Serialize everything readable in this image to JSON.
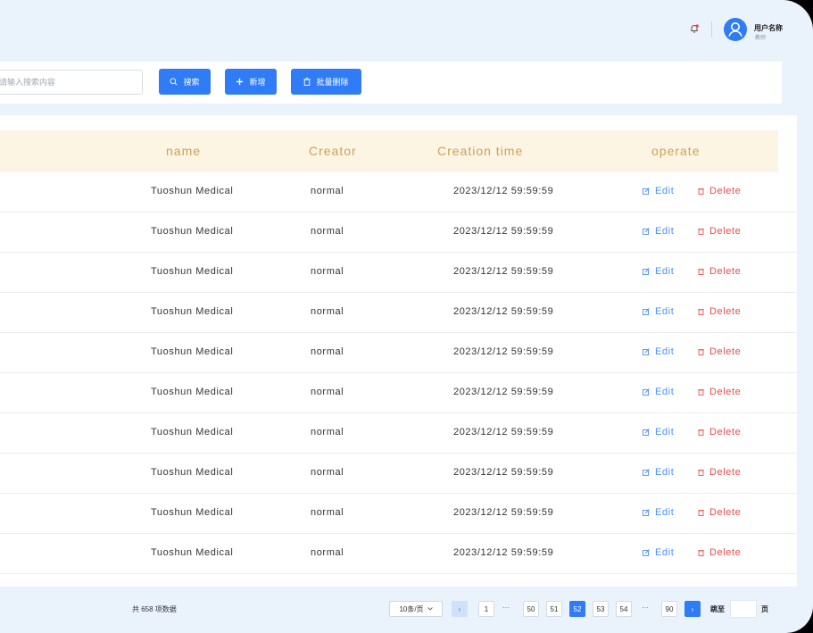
{
  "header": {
    "user_name": "用户名称",
    "user_role": "教师"
  },
  "toolbar": {
    "search_placeholder": "请输入搜索内容",
    "search_label": "搜索",
    "add_label": "新增",
    "batch_delete_label": "批量删除"
  },
  "table": {
    "columns": [
      "name",
      "Creator",
      "Creation time",
      "operate"
    ],
    "rows": [
      {
        "name": "Tuoshun Medical",
        "creator": "normal",
        "time": "2023/12/12  59:59:59"
      },
      {
        "name": "Tuoshun Medical",
        "creator": "normal",
        "time": "2023/12/12  59:59:59"
      },
      {
        "name": "Tuoshun Medical",
        "creator": "normal",
        "time": "2023/12/12  59:59:59"
      },
      {
        "name": "Tuoshun Medical",
        "creator": "normal",
        "time": "2023/12/12  59:59:59"
      },
      {
        "name": "Tuoshun Medical",
        "creator": "normal",
        "time": "2023/12/12  59:59:59"
      },
      {
        "name": "Tuoshun Medical",
        "creator": "normal",
        "time": "2023/12/12  59:59:59"
      },
      {
        "name": "Tuoshun Medical",
        "creator": "normal",
        "time": "2023/12/12  59:59:59"
      },
      {
        "name": "Tuoshun Medical",
        "creator": "normal",
        "time": "2023/12/12  59:59:59"
      },
      {
        "name": "Tuoshun Medical",
        "creator": "normal",
        "time": "2023/12/12  59:59:59"
      },
      {
        "name": "Tuoshun Medical",
        "creator": "normal",
        "time": "2023/12/12  59:59:59"
      }
    ],
    "edit_label": "Edit",
    "delete_label": "Delete"
  },
  "pagination": {
    "total_text": "共 658 项数据",
    "page_size": "10条/页",
    "pages": [
      "1",
      "50",
      "51",
      "52",
      "53",
      "54",
      "90"
    ],
    "current_page": "52",
    "ellipsis": "···",
    "prev": "‹",
    "next": "›",
    "jump_label": "跳至",
    "jump_unit": "页"
  },
  "colors": {
    "primary": "#2f7cf6",
    "header_text": "#caa258",
    "header_bg": "#fdf5e3",
    "edit": "#4a8ff7",
    "delete": "#e64c4c",
    "page_bg": "#eaf2fc"
  }
}
